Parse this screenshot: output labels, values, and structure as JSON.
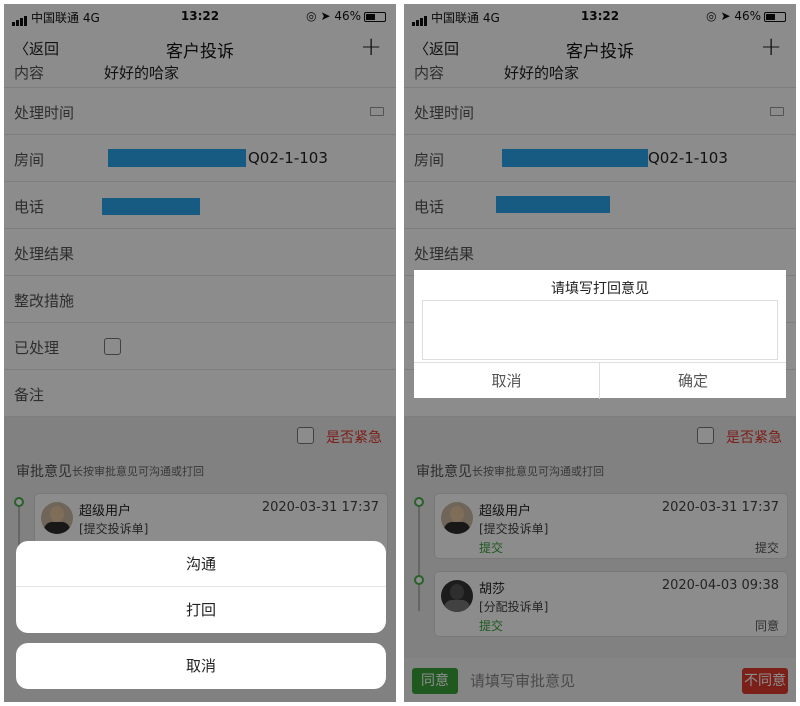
{
  "status": {
    "carrier": "中国联通",
    "network": "4G",
    "time": "13:22",
    "battery": "46%"
  },
  "nav": {
    "back_label": "返回",
    "title": "客户投诉",
    "plus": "+"
  },
  "form": {
    "content_label": "内容",
    "content_value": "好好的哈家",
    "time_label": "处理时间",
    "room_label": "房间",
    "room_value": "Q02-1-103",
    "phone_label": "电话",
    "result_label": "处理结果",
    "measure_label": "整改措施",
    "handled_label": "已处理",
    "remark_label": "备注"
  },
  "urgent_label": "是否紧急",
  "approval": {
    "title": "审批意见",
    "hint": "长按审批意见可沟通或打回"
  },
  "records": [
    {
      "name": "超级用户",
      "date": "2020-03-31 17:37",
      "type": "[提交投诉单]",
      "status": "提交",
      "action": "提交"
    },
    {
      "name": "胡莎",
      "date": "2020-04-03 09:38",
      "type": "[分配投诉单]",
      "status": "提交",
      "action": "同意"
    }
  ],
  "action_sheet": {
    "communicate": "沟通",
    "reject": "打回",
    "cancel": "取消"
  },
  "dialog": {
    "title": "请填写打回意见",
    "cancel": "取消",
    "confirm": "确定"
  },
  "bottom": {
    "agree": "同意",
    "placeholder": "请填写审批意见",
    "disagree": "不同意"
  },
  "colors": {
    "urgent": "#e0392f",
    "agree": "#3aa33a",
    "redact": "#2aa7ef"
  }
}
